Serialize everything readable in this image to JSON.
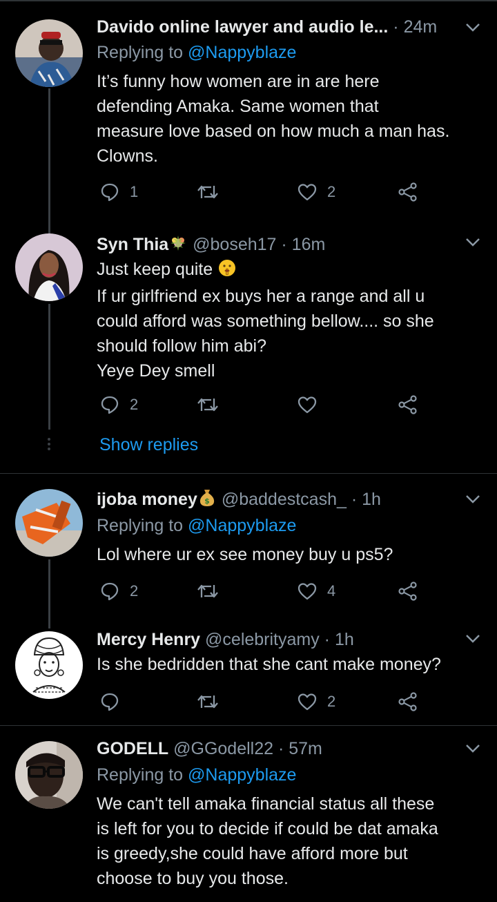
{
  "tweets": [
    {
      "name": "Davido online lawyer and audio le...",
      "handle": "",
      "time": "24m",
      "replying_label": "Replying to",
      "replying_to": "@Nappyblaze",
      "lines": [
        "It’s funny how women are in are here",
        "defending Amaka. Same women that",
        "measure love based on how much a man has.",
        "Clowns."
      ],
      "reply_count": "1",
      "retweet_count": "",
      "like_count": "2"
    },
    {
      "name": "Syn Thia",
      "name_emoji": "sparkle-bouquet-icon",
      "handle": "@boseh17",
      "time": "16m",
      "lines": [
        "Just keep quite",
        "If ur girlfriend ex buys her a range and all u",
        "could afford was something bellow.... so she",
        "should follow him abi?",
        "Yeye Dey smell"
      ],
      "line_emoji": "shushing-face-icon",
      "reply_count": "2",
      "retweet_count": "",
      "like_count": "",
      "show_replies": "Show replies"
    },
    {
      "name": "ijoba money",
      "name_emoji": "money-bag-icon",
      "handle": "@baddestcash_",
      "time": "1h",
      "replying_label": "Replying to",
      "replying_to": "@Nappyblaze",
      "lines": [
        "Lol where ur ex see money buy u ps5?"
      ],
      "reply_count": "2",
      "retweet_count": "",
      "like_count": "4"
    },
    {
      "name": "Mercy Henry",
      "handle": "@celebrityamy",
      "time": "1h",
      "lines": [
        "Is she bedridden that she cant make money?"
      ],
      "reply_count": "",
      "retweet_count": "",
      "like_count": "2"
    },
    {
      "name": "GODELL",
      "handle": "@GGodell22",
      "time": "57m",
      "replying_label": "Replying to",
      "replying_to": "@Nappyblaze",
      "lines": [
        "We can't tell amaka financial status all these",
        "is left for you to decide if could be dat amaka",
        "is greedy,she could have afford more but",
        "choose to buy you those."
      ]
    }
  ],
  "colors": {
    "background": "#000000",
    "text": "#e7e9ea",
    "muted": "#8b98a5",
    "accent": "#1d9bf0",
    "divider": "#2f3336"
  }
}
